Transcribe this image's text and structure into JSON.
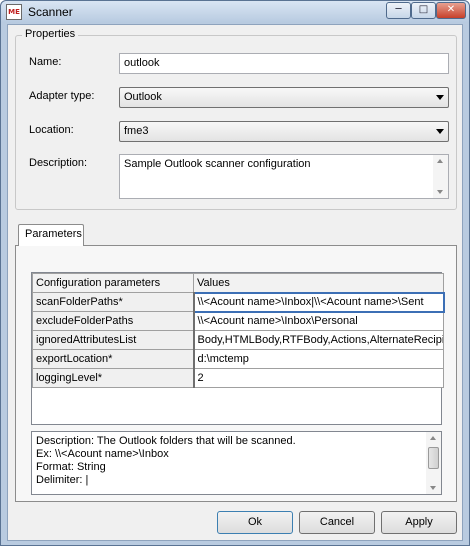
{
  "window": {
    "title": "Scanner",
    "icon_label": "ME",
    "controls": {
      "minimize": "─",
      "maximize": "□",
      "close": "✕"
    }
  },
  "properties": {
    "group_label": "Properties",
    "name_label": "Name:",
    "name_value": "outlook",
    "adapter_label": "Adapter type:",
    "adapter_value": "Outlook",
    "location_label": "Location:",
    "location_value": "fme3",
    "description_label": "Description:",
    "description_value": "Sample Outlook scanner configuration"
  },
  "parameters": {
    "tab_label": "Parameters",
    "columns": [
      "Configuration parameters",
      "Values"
    ],
    "rows": [
      {
        "name": "scanFolderPaths*",
        "value": "\\\\<Acount name>\\Inbox|\\\\<Acount name>\\Sent"
      },
      {
        "name": "excludeFolderPaths",
        "value": "\\\\<Acount name>\\Inbox\\Personal"
      },
      {
        "name": "ignoredAttributesList",
        "value": "Body,HTMLBody,RTFBody,Actions,AlternateRecipie"
      },
      {
        "name": "exportLocation*",
        "value": "d:\\mctemp"
      },
      {
        "name": "loggingLevel*",
        "value": "2"
      }
    ],
    "description_lines": [
      "Description: The Outlook folders that will be scanned.",
      "Ex: \\\\<Acount name>\\Inbox",
      "Format: String",
      "Delimiter: |"
    ]
  },
  "buttons": {
    "ok": "Ok",
    "cancel": "Cancel",
    "apply": "Apply"
  }
}
